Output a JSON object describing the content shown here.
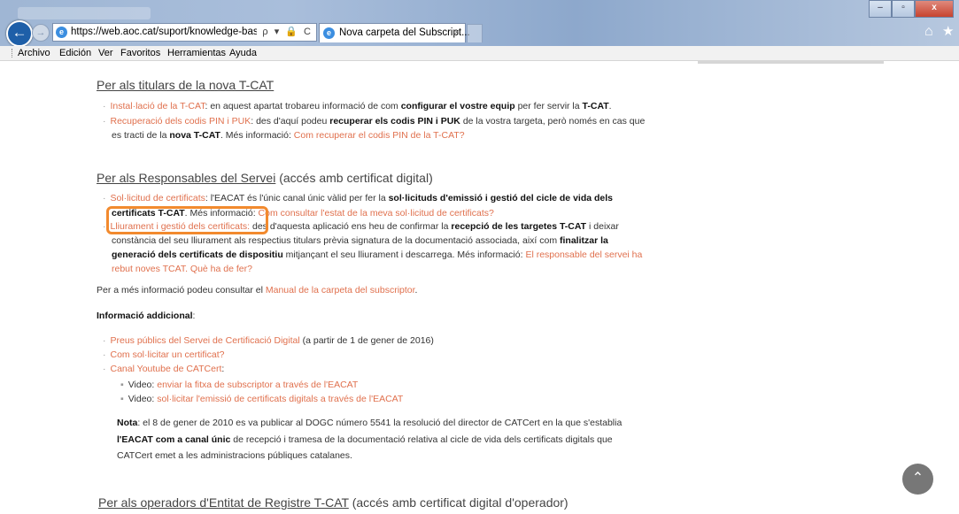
{
  "browser": {
    "url": "https://web.aoc.cat/suport/knowledge-base/nova-",
    "address_tools": "ρ ▾ 🔒 C",
    "tab_title": "Nova carpeta del Subscript...",
    "tab_close": "×",
    "back_symbol": "←",
    "forward_symbol": "→",
    "window_min": "–",
    "window_max": "▫",
    "window_close": "x",
    "ie_icon_glyph": "e",
    "home_glyph": "⌂",
    "favorites_glyph": "★",
    "menu": [
      "Archivo",
      "Edición",
      "Ver",
      "Favoritos",
      "Herramientas",
      "Ayuda"
    ]
  },
  "section1": {
    "title": "Per als titulars de la nova T-CAT",
    "items": [
      {
        "link": "Instal·lació de la T-CAT",
        "t1": ": en aquest apartat trobareu informació de com ",
        "b1": "configurar el vostre equip",
        "t2": " per fer servir la ",
        "b2": "T-CAT",
        "t3": "."
      },
      {
        "link": "Recuperació dels codis PIN i PUK",
        "t1": ": des d'aquí podeu ",
        "b1": "recuperar els codis PIN i PUK",
        "t2": " de la vostra targeta, però només en cas que",
        "line2_t1": "es tracti de la ",
        "line2_b1": "nova T-CAT",
        "line2_t2": ". Més informació: ",
        "line2_link": "Com recuperar el codis PIN de la T-CAT?"
      }
    ]
  },
  "section2": {
    "title_u": "Per als Responsables del Servei",
    "title_rest": " (accés amb certificat digital)",
    "item1": {
      "link": "Sol·licitud de certificats",
      "t1": ": l'EACAT és l'únic canal únic vàlid per fer la ",
      "b1": "sol·licituds d'emissió i gestió del cicle de vida dels",
      "line2_b1": "certificats T-CAT",
      "line2_t1": ". Més informació: ",
      "line2_link": "Com consultar l'estat de la meva sol·licitud de certificats?"
    },
    "item2": {
      "link": "Lliurament i gestió dels certificats:",
      "t1": " des d'aquesta aplicació ens heu de confirmar la ",
      "b1": "recepció de les targetes T-CAT",
      "t2": " i deixar",
      "line2": "constància del seu lliurament als respectius titulars prèvia signatura de la documentació associada, així com ",
      "line2_b": "finalitzar la",
      "line3_b": "generació dels certificats de dispositiu",
      "line3_t": " mitjançant el seu lliurament i descarrega. Més informació: ",
      "line3_link": "El responsable del servei ha",
      "line4_link": "rebut noves TCAT. Què ha de fer?"
    },
    "manual_text": "Per a més informació podeu consultar el ",
    "manual_link": "Manual de la carpeta del subscriptor",
    "manual_end": "."
  },
  "additional": {
    "heading": "Informació addicional",
    "heading_colon": ":",
    "items": [
      {
        "link": "Preus públics del Servei de Certificació Digital",
        "text": " (a partir de 1 de gener de 2016)"
      },
      {
        "link": "Com sol·licitar un certificat?",
        "text": ""
      },
      {
        "link": "Canal Youtube de CATCert",
        "text": ":"
      }
    ],
    "videos": [
      {
        "label": "Video: ",
        "link": "enviar la fitxa de subscriptor a través de l'EACAT"
      },
      {
        "label": "Video: ",
        "link": "sol·licitar l'emissió de certificats digitals a través de l'EACAT"
      }
    ],
    "note": {
      "b1": "Nota",
      "t1": ": el 8 de gener de 2010 es va publicar al DOGC número 5541 la resolució del director de CATCert en la que s'establia",
      "b2": "l'EACAT com a canal únic",
      "t2": " de recepció i tramesa de la documentació relativa al cicle de vida dels certificats digitals que",
      "t3": "CATCert emet a les administracions públiques catalanes."
    }
  },
  "section3": {
    "title_u": "Per als operadors d'Entitat de Registre T-CAT",
    "title_rest": " (accés amb certificat digital d'operador)"
  },
  "scroll_top_glyph": "⌃",
  "colors": {
    "link": "#e0704d",
    "highlight": "#f28a2e"
  }
}
